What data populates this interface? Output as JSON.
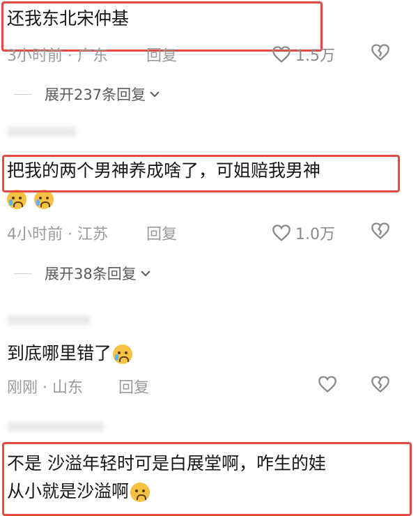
{
  "comments": [
    {
      "text": "还我东北宋仲基",
      "time": "3小时前 · 广东",
      "reply": "回复",
      "likes": "1.5万",
      "expand": "展开237条回复"
    },
    {
      "text": "把我的两个男神养成啥了，可姐赔我男神",
      "time": "4小时前 · 江苏",
      "reply": "回复",
      "likes": "1.0万",
      "expand": "展开38条回复"
    },
    {
      "text": "到底哪里错了",
      "time": "刚刚 · 山东",
      "reply": "回复",
      "likes": ""
    },
    {
      "text_line1": "不是 沙溢年轻时可是白展堂啊，咋生的娃",
      "text_line2": "从小就是沙溢啊"
    }
  ],
  "icons": {
    "like": "heart-outline-icon",
    "dislike": "broken-heart-icon",
    "expand": "chevron-down-icon",
    "emoji_cry": "crying-face-emoji",
    "emoji_pleading": "pleading-face-emoji"
  },
  "colors": {
    "highlight_box": "#e34a3f",
    "meta_text": "#9a9a9a",
    "expand_text": "#5a5a5a"
  }
}
